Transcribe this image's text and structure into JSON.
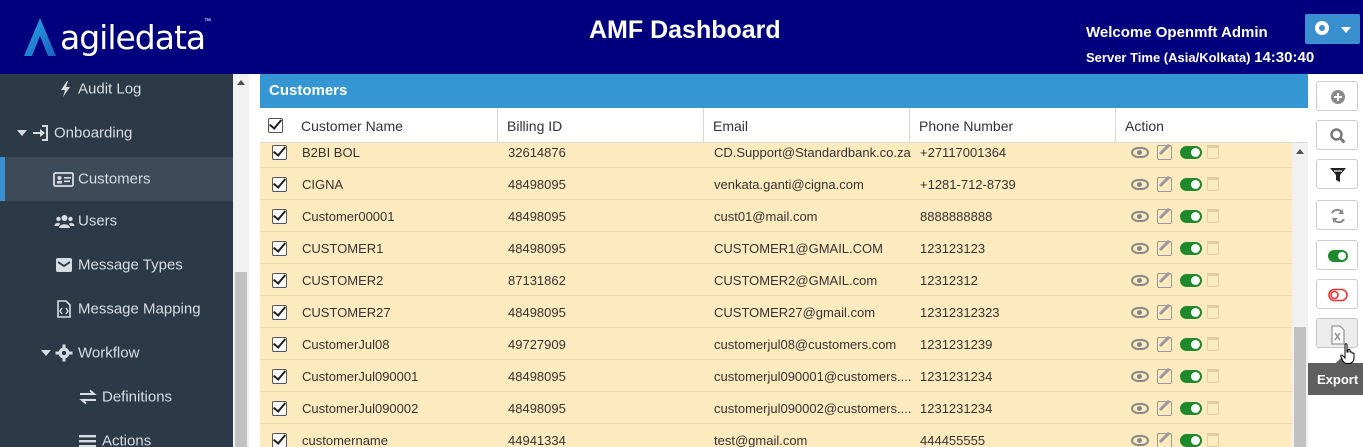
{
  "header": {
    "logo_text": "agiledata",
    "logo_tm": "™",
    "title": "AMF Dashboard",
    "welcome": "Welcome Openmft Admin",
    "server_time_label": "Server Time (Asia/Kolkata)",
    "server_time_value": "14:30:40"
  },
  "sidebar": {
    "items": [
      {
        "label": "Audit Log",
        "icon": "bolt-icon"
      },
      {
        "label": "Onboarding",
        "icon": "sign-in-icon"
      },
      {
        "label": "Customers",
        "icon": "id-card-icon"
      },
      {
        "label": "Users",
        "icon": "users-icon"
      },
      {
        "label": "Message Types",
        "icon": "envelope-icon"
      },
      {
        "label": "Message Mapping",
        "icon": "file-code-icon"
      },
      {
        "label": "Workflow",
        "icon": "gear-icon"
      },
      {
        "label": "Definitions",
        "icon": "exchange-icon"
      },
      {
        "label": "Actions",
        "icon": "list-icon"
      }
    ]
  },
  "panel": {
    "title": "Customers"
  },
  "table": {
    "columns": [
      "Customer Name",
      "Billing ID",
      "Email",
      "Phone Number",
      "Action"
    ],
    "rows": [
      {
        "name": "B2BI BOL",
        "billing": "32614876",
        "email": "CD.Support@Standardbank.co.za",
        "phone": "+27117001364"
      },
      {
        "name": "CIGNA",
        "billing": "48498095",
        "email": "venkata.ganti@cigna.com",
        "phone": "+1281-712-8739"
      },
      {
        "name": "Customer00001",
        "billing": "48498095",
        "email": "cust01@mail.com",
        "phone": "8888888888"
      },
      {
        "name": "CUSTOMER1",
        "billing": "48498095",
        "email": "CUSTOMER1@GMAIL.COM",
        "phone": "123123123"
      },
      {
        "name": "CUSTOMER2",
        "billing": "87131862",
        "email": "CUSTOMER2@GMAIL.com",
        "phone": "12312312"
      },
      {
        "name": "CUSTOMER27",
        "billing": "48498095",
        "email": "CUSTOMER27@gmail.com",
        "phone": "12312312323"
      },
      {
        "name": "CustomerJul08",
        "billing": "49727909",
        "email": "customerjul08@customers.com",
        "phone": "1231231239"
      },
      {
        "name": "CustomerJul090001",
        "billing": "48498095",
        "email": "customerjul090001@customers....",
        "phone": "1231231234"
      },
      {
        "name": "CustomerJul090002",
        "billing": "48498095",
        "email": "customerjul090002@customers....",
        "phone": "1231231234"
      },
      {
        "name": "customername",
        "billing": "44941334",
        "email": "test@gmail.com",
        "phone": "444455555"
      }
    ]
  },
  "tools": {
    "items": [
      "plus-circle-icon",
      "search-icon",
      "filter-icon",
      "refresh-icon",
      "toggle-on-icon",
      "toggle-off-icon",
      "excel-export-icon"
    ],
    "tooltip": "Export"
  },
  "colors": {
    "header_bg": "#00007e",
    "sidebar_bg": "#2c3a47",
    "panel_head": "#3497d4",
    "row_bg": "#fdebbf",
    "toggle_on": "#1e8a2b",
    "toggle_off": "#e53935"
  }
}
